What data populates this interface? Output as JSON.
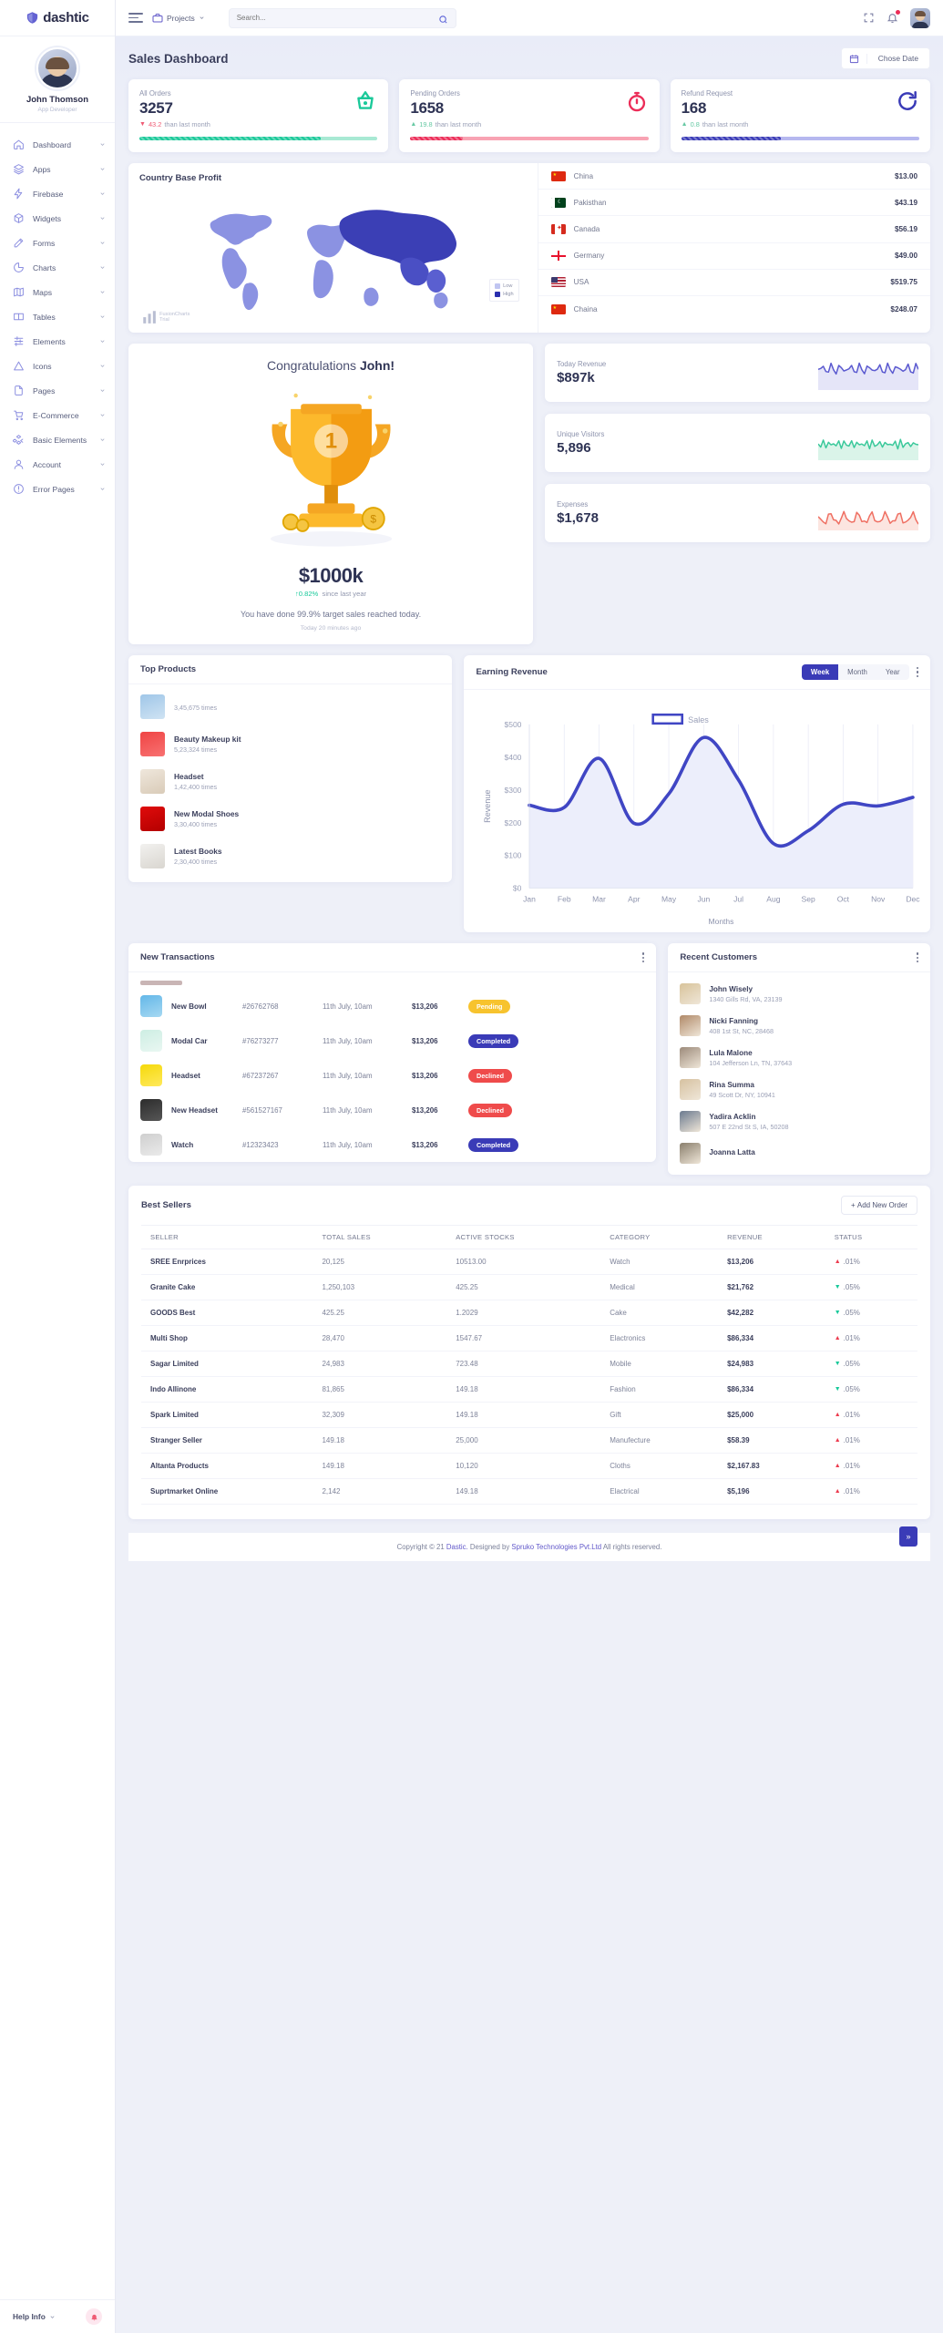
{
  "brand": {
    "name": "dashtic",
    "logo_icon": "shield-logo-icon"
  },
  "sidebar": {
    "profile": {
      "name": "John Thomson",
      "role": "App Developer"
    },
    "items": [
      {
        "label": "Dashboard",
        "icon": "home-icon"
      },
      {
        "label": "Apps",
        "icon": "layers-icon"
      },
      {
        "label": "Firebase",
        "icon": "bolt-icon"
      },
      {
        "label": "Widgets",
        "icon": "box-icon"
      },
      {
        "label": "Forms",
        "icon": "edit-icon"
      },
      {
        "label": "Charts",
        "icon": "pie-chart-icon"
      },
      {
        "label": "Maps",
        "icon": "map-icon"
      },
      {
        "label": "Tables",
        "icon": "table-icon"
      },
      {
        "label": "Elements",
        "icon": "sliders-icon"
      },
      {
        "label": "Icons",
        "icon": "triangle-icon"
      },
      {
        "label": "Pages",
        "icon": "file-icon"
      },
      {
        "label": "E-Commerce",
        "icon": "cart-icon"
      },
      {
        "label": "Basic Elements",
        "icon": "grid-icon"
      },
      {
        "label": "Account",
        "icon": "user-icon"
      },
      {
        "label": "Error Pages",
        "icon": "alert-icon"
      }
    ],
    "help": {
      "label": "Help Info",
      "bell_icon": "bell-icon"
    }
  },
  "topbar": {
    "menu_icon": "hamburger-icon",
    "projects_label": "Projects",
    "projects_icon": "briefcase-icon",
    "search_placeholder": "Search...",
    "search_value": "",
    "search_icon": "search-icon",
    "fullscreen_icon": "fullscreen-icon",
    "notification_icon": "bell-icon",
    "avatar_icon": "user-avatar"
  },
  "header": {
    "title": "Sales Dashboard",
    "date_button": "Chose Date",
    "calendar_icon": "calendar-icon"
  },
  "stats": [
    {
      "label": "All Orders",
      "value": "3257",
      "delta": "43.2",
      "delta_suffix": "than last month",
      "direction": "down",
      "delta_color": "#ef5b74",
      "bar_color": "#1bc99a",
      "bar_track": "#a9e9d4",
      "progress": 76,
      "icon": "basket-icon",
      "icon_color": "#1bc99a"
    },
    {
      "label": "Pending Orders",
      "value": "1658",
      "delta": "19.8",
      "delta_suffix": "than last month",
      "direction": "up",
      "delta_color": "#67c9a4",
      "bar_color": "#ec2d58",
      "bar_track": "#f8a3b3",
      "progress": 22,
      "icon": "stopwatch-icon",
      "icon_color": "#ec2d58"
    },
    {
      "label": "Refund Request",
      "value": "168",
      "delta": "0.8",
      "delta_suffix": "than last month",
      "direction": "up",
      "delta_color": "#67c9a4",
      "bar_color": "#3a3bb7",
      "bar_track": "#b6b8ef",
      "progress": 42,
      "icon": "refresh-icon",
      "icon_color": "#3a3bb7"
    }
  ],
  "country_profit": {
    "title": "Country Base Profit",
    "legend": {
      "low": "Low",
      "high": "High",
      "low_color": "#c0c5f1",
      "high_color": "#2a2fae"
    },
    "credit": "FusionCharts Trial",
    "rows": [
      {
        "country": "China",
        "value": "$13.00",
        "flag": "cn"
      },
      {
        "country": "Pakisthan",
        "value": "$43.19",
        "flag": "pk"
      },
      {
        "country": "Canada",
        "value": "$56.19",
        "flag": "ca"
      },
      {
        "country": "Germany",
        "value": "$49.00",
        "flag": "ge"
      },
      {
        "country": "USA",
        "value": "$519.75",
        "flag": "us"
      },
      {
        "country": "Chaina",
        "value": "$248.07",
        "flag": "cn"
      }
    ]
  },
  "congrats": {
    "greeting_prefix": "Congratulations ",
    "greeting_name": "John!",
    "trophy_icon": "trophy-icon",
    "amount": "$1000k",
    "change": "0.82%",
    "change_note": "since last year",
    "message": "You have done 99.9% target sales reached today.",
    "time": "Today 20 minutes ago"
  },
  "mini_cards": [
    {
      "label": "Today Revenue",
      "value": "$897k",
      "color": "#5b5ad0",
      "fill": "#dcdcf6"
    },
    {
      "label": "Unique Visitors",
      "value": "5,896",
      "color": "#3bc99b",
      "fill": "#cdf0e2"
    },
    {
      "label": "Expenses",
      "value": "$1,678",
      "color": "#ef6f62",
      "fill": "#fbdcd6"
    }
  ],
  "top_products": {
    "title": "Top Products",
    "items": [
      {
        "name": "",
        "times": "3,45,675 times",
        "img": "shoes-blue"
      },
      {
        "name": "Beauty Makeup kit",
        "times": "5,23,324 times",
        "img": "makeup-red"
      },
      {
        "name": "Headset",
        "times": "1,42,400 times",
        "img": "headset-beige"
      },
      {
        "name": "New Modal Shoes",
        "times": "3,30,400 times",
        "img": "shoe-red"
      },
      {
        "name": "Latest Books",
        "times": "2,30,400 times",
        "img": "books-white"
      }
    ]
  },
  "earning_revenue": {
    "title": "Earning Revenue",
    "tabs": [
      {
        "label": "Week",
        "active": true
      },
      {
        "label": "Month",
        "active": false
      },
      {
        "label": "Year",
        "active": false
      }
    ],
    "menu_icon": "more-vertical-icon"
  },
  "chart_data": {
    "type": "area",
    "title": "Earning Revenue",
    "xlabel": "Months",
    "ylabel": "Revenue",
    "legend": [
      "Sales"
    ],
    "legend_position": "top-center",
    "grid": true,
    "ylim": [
      0,
      500
    ],
    "yticks": [
      "$0",
      "$100",
      "$200",
      "$300",
      "$400",
      "$500"
    ],
    "categories": [
      "Jan",
      "Feb",
      "Mar",
      "Apr",
      "May",
      "Jun",
      "Jul",
      "Aug",
      "Sep",
      "Oct",
      "Nov",
      "Dec"
    ],
    "series": [
      {
        "name": "Sales",
        "color": "#4046c4",
        "values": [
          253,
          246,
          396,
          198,
          288,
          460,
          330,
          136,
          175,
          256,
          251,
          277
        ]
      }
    ]
  },
  "new_transactions": {
    "title": "New Transactions",
    "menu_icon": "more-vertical-icon",
    "rows": [
      {
        "name": "New Bowl",
        "id": "#26762768",
        "date": "11th July, 10am",
        "amount": "$13,206",
        "status": "Pending",
        "status_color": "#f7c32e",
        "img": "bowl-blue"
      },
      {
        "name": "Modal Car",
        "id": "#76273277",
        "date": "11th July, 10am",
        "amount": "$13,206",
        "status": "Completed",
        "status_color": "#3a3bb7",
        "img": "car-mint"
      },
      {
        "name": "Headset",
        "id": "#67237267",
        "date": "11th July, 10am",
        "amount": "$13,206",
        "status": "Declined",
        "status_color": "#ef4b4b",
        "img": "headset-yellow"
      },
      {
        "name": "New Headset",
        "id": "#561527167",
        "date": "11th July, 10am",
        "amount": "$13,206",
        "status": "Declined",
        "status_color": "#ef4b4b",
        "img": "earbuds-dark"
      },
      {
        "name": "Watch",
        "id": "#12323423",
        "date": "11th July, 10am",
        "amount": "$13,206",
        "status": "Completed",
        "status_color": "#3a3bb7",
        "img": "watch-grey"
      }
    ]
  },
  "recent_customers": {
    "title": "Recent Customers",
    "menu_icon": "more-vertical-icon",
    "rows": [
      {
        "name": "John Wisely",
        "address": "1340 Gills Rd, VA, 23139",
        "avatar": "c1"
      },
      {
        "name": "Nicki Fanning",
        "address": "408 1st St, NC, 28468",
        "avatar": "c2"
      },
      {
        "name": "Lula Malone",
        "address": "104 Jefferson Ln, TN, 37643",
        "avatar": "c3"
      },
      {
        "name": "Rina Summa",
        "address": "49 Scott Dr, NY, 10941",
        "avatar": "c4"
      },
      {
        "name": "Yadira Acklin",
        "address": "507 E 22nd St S, IA, 50208",
        "avatar": "c5"
      },
      {
        "name": "Joanna Latta",
        "address": "",
        "avatar": "c6"
      }
    ]
  },
  "best_sellers": {
    "title": "Best Sellers",
    "add_button": "Add New Order",
    "columns": [
      "SELLER",
      "TOTAL SALES",
      "ACTIVE STOCKS",
      "CATEGORY",
      "REVENUE",
      "STATUS"
    ],
    "rows": [
      {
        "seller": "SREE Enrprices",
        "total_sales": "20,125",
        "active_stocks": "10513.00",
        "category": "Watch",
        "revenue": "$13,206",
        "status": ".01%",
        "dir": "up",
        "color": "#ec3c4f"
      },
      {
        "seller": "Granite Cake",
        "total_sales": "1,250,103",
        "active_stocks": "425.25",
        "category": "Medical",
        "revenue": "$21,762",
        "status": ".05%",
        "dir": "down",
        "color": "#18c99a"
      },
      {
        "seller": "GOODS Best",
        "total_sales": "425.25",
        "active_stocks": "1.2029",
        "category": "Cake",
        "revenue": "$42,282",
        "status": ".05%",
        "dir": "down",
        "color": "#18c99a"
      },
      {
        "seller": "Multi Shop",
        "total_sales": "28,470",
        "active_stocks": "1547.67",
        "category": "Elactronics",
        "revenue": "$86,334",
        "status": ".01%",
        "dir": "up",
        "color": "#ec3c4f"
      },
      {
        "seller": "Sagar Limited",
        "total_sales": "24,983",
        "active_stocks": "723.48",
        "category": "Mobile",
        "revenue": "$24,983",
        "status": ".05%",
        "dir": "down",
        "color": "#18c99a"
      },
      {
        "seller": "Indo Allinone",
        "total_sales": "81,865",
        "active_stocks": "149.18",
        "category": "Fashion",
        "revenue": "$86,334",
        "status": ".05%",
        "dir": "down",
        "color": "#18c99a"
      },
      {
        "seller": "Spark Limited",
        "total_sales": "32,309",
        "active_stocks": "149.18",
        "category": "Gift",
        "revenue": "$25,000",
        "status": ".01%",
        "dir": "up",
        "color": "#ec3c4f"
      },
      {
        "seller": "Stranger Seller",
        "total_sales": "149.18",
        "active_stocks": "25,000",
        "category": "Manufecture",
        "revenue": "$58.39",
        "status": ".01%",
        "dir": "up",
        "color": "#ec3c4f"
      },
      {
        "seller": "Altanta Products",
        "total_sales": "149.18",
        "active_stocks": "10,120",
        "category": "Cloths",
        "revenue": "$2,167.83",
        "status": ".01%",
        "dir": "up",
        "color": "#ec3c4f"
      },
      {
        "seller": "Suprtmarket Online",
        "total_sales": "2,142",
        "active_stocks": "149.18",
        "category": "Elactrical",
        "revenue": "$5,196",
        "status": ".01%",
        "dir": "up",
        "color": "#ec3c4f"
      }
    ]
  },
  "footer": {
    "copyright_pre": "Copyright © 21 ",
    "brand": "Dastic.",
    "mid": " Designed by ",
    "company": "Spruko Technologies Pvt.Ltd",
    "post": " All rights reserved.",
    "to_top_icon": "chevron-up-icon"
  }
}
